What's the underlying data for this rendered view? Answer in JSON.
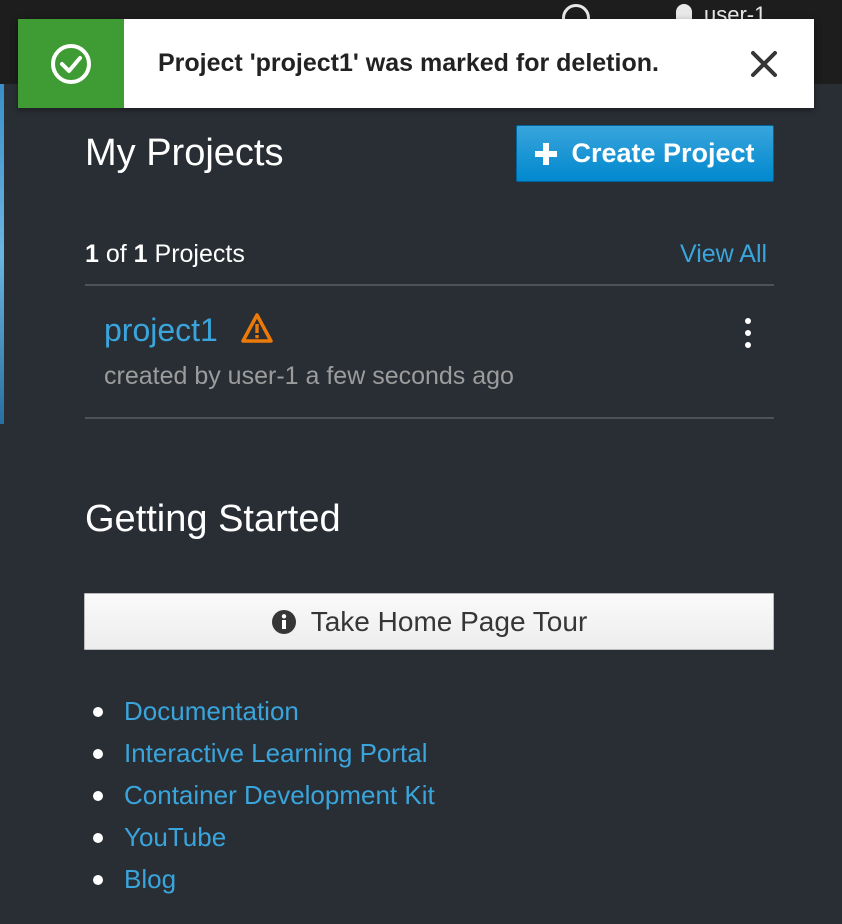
{
  "topbar": {
    "username": "user-1"
  },
  "toast": {
    "message": "Project 'project1' was marked for deletion.",
    "icon": "check-circle-icon",
    "close_icon": "close-icon",
    "status_color": "#3f9c35"
  },
  "my_projects": {
    "title": "My Projects",
    "create_label": "Create Project",
    "count_current": "1",
    "count_of": "of",
    "count_total": "1",
    "count_suffix": "Projects",
    "view_all": "View All"
  },
  "projects": [
    {
      "name": "project1",
      "meta": "created by user-1 a few seconds ago",
      "status_icon": "warning-triangle-icon"
    }
  ],
  "getting_started": {
    "title": "Getting Started",
    "tour_label": "Take Home Page Tour",
    "links": [
      "Documentation",
      "Interactive Learning Portal",
      "Container Development Kit",
      "YouTube",
      "Blog"
    ]
  },
  "colors": {
    "accent": "#39a5dc",
    "background": "#292e34",
    "warning": "#ec7a08"
  }
}
